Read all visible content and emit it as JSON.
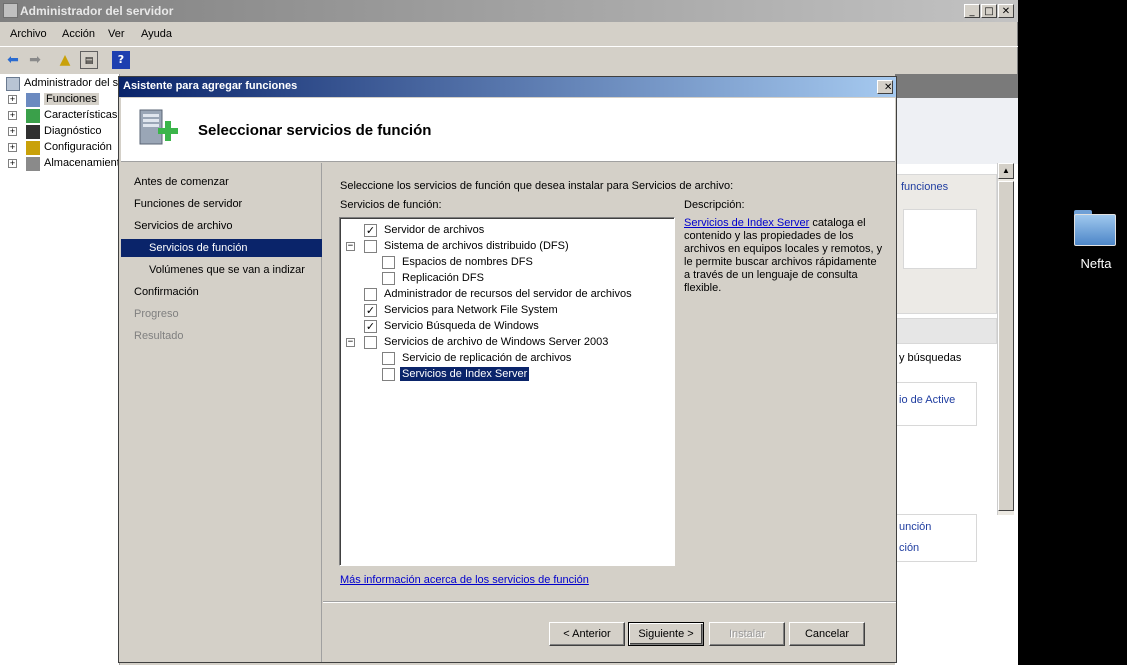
{
  "main_window": {
    "title": "Administrador del servidor",
    "controls": {
      "minimize": "_",
      "maximize": "□",
      "close": "✕"
    },
    "menu": [
      "Archivo",
      "Acción",
      "Ver",
      "Ayuda"
    ],
    "toolbar_icons": [
      "back-arrow-icon",
      "forward-arrow-icon",
      "up-folder-icon",
      "console-tree-icon",
      "help-icon"
    ],
    "tree": {
      "root": "Administrador del se",
      "items": [
        "Funciones",
        "Características",
        "Diagnóstico",
        "Configuración",
        "Almacenamiento"
      ]
    },
    "right_pane": {
      "link_funciones": "funciones",
      "text_busquedas": "y búsquedas",
      "link_active": "io de Active",
      "link_funcion": "unción",
      "link_cion": "ción"
    }
  },
  "desktop": {
    "icon_label": "Nefta"
  },
  "dialog": {
    "title": "Asistente para agregar funciones",
    "close": "✕",
    "heading": "Seleccionar servicios de función",
    "nav": [
      {
        "label": "Antes de comenzar",
        "state": "normal"
      },
      {
        "label": "Funciones de servidor",
        "state": "normal"
      },
      {
        "label": "Servicios de archivo",
        "state": "normal"
      },
      {
        "label": "Servicios de función",
        "state": "active"
      },
      {
        "label": "Volúmenes que se van a indizar",
        "state": "normal"
      },
      {
        "label": "Confirmación",
        "state": "normal"
      },
      {
        "label": "Progreso",
        "state": "disabled"
      },
      {
        "label": "Resultado",
        "state": "disabled"
      }
    ],
    "intro": "Seleccione los servicios de función que desea instalar para Servicios de archivo:",
    "list_label": "Servicios de función:",
    "services": [
      {
        "label": "Servidor de archivos",
        "checked": true,
        "level": 0
      },
      {
        "label": "Sistema de archivos distribuido (DFS)",
        "checked": false,
        "level": 0,
        "expander": "−"
      },
      {
        "label": "Espacios de nombres DFS",
        "checked": false,
        "level": 1
      },
      {
        "label": "Replicación DFS",
        "checked": false,
        "level": 1
      },
      {
        "label": "Administrador de recursos del servidor de archivos",
        "checked": false,
        "level": 0
      },
      {
        "label": "Servicios para Network File System",
        "checked": true,
        "level": 0
      },
      {
        "label": "Servicio Búsqueda de Windows",
        "checked": true,
        "level": 0
      },
      {
        "label": "Servicios de archivo de Windows Server 2003",
        "checked": false,
        "level": 0,
        "expander": "−"
      },
      {
        "label": "Servicio de replicación de archivos",
        "checked": false,
        "level": 1
      },
      {
        "label": "Servicios de Index Server",
        "checked": false,
        "level": 1,
        "selected": true
      }
    ],
    "description_label": "Descripción:",
    "description_link": "Servicios de Index Server",
    "description_text": " cataloga el contenido y las propiedades de los archivos en equipos locales y remotos, y le permite buscar archivos rápidamente a través de un lenguaje de consulta flexible.",
    "more_info_link": "Más información acerca de los servicios de función",
    "buttons": {
      "back": "< Anterior",
      "next": "Siguiente >",
      "install": "Instalar",
      "cancel": "Cancelar"
    }
  }
}
